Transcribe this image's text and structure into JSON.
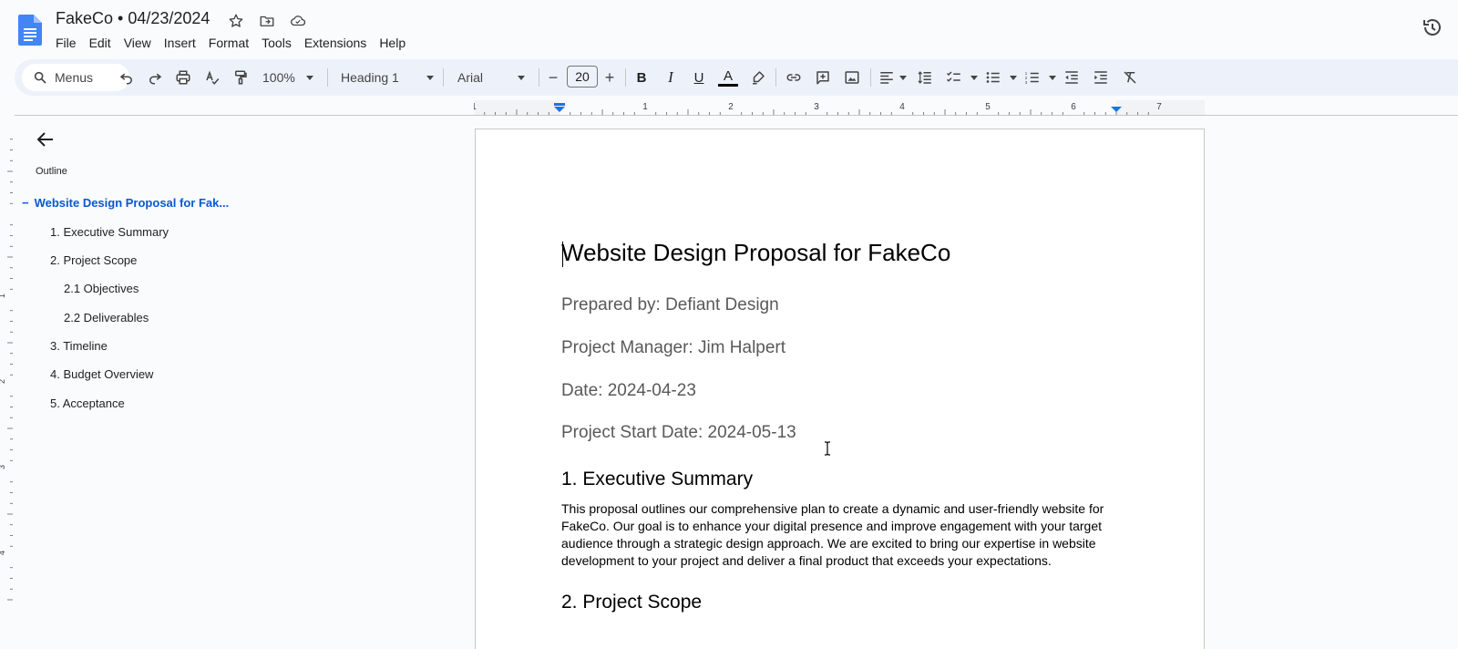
{
  "doc": {
    "title": "FakeCo • 04/23/2024"
  },
  "menu": [
    "File",
    "Edit",
    "View",
    "Insert",
    "Format",
    "Tools",
    "Extensions",
    "Help"
  ],
  "toolbar": {
    "search_label": "Menus",
    "zoom": "100%",
    "style": "Heading 1",
    "font": "Arial",
    "font_size": "20",
    "minus": "−",
    "plus": "+",
    "bold": "B",
    "italic": "I",
    "underline": "U",
    "text_color": "A"
  },
  "sidebar": {
    "outline_label": "Outline",
    "items": [
      {
        "label": "Website Design Proposal for Fak..."
      },
      {
        "label": "1. Executive Summary"
      },
      {
        "label": "2. Project Scope"
      },
      {
        "label": "2.1 Objectives"
      },
      {
        "label": "2.2 Deliverables"
      },
      {
        "label": "3. Timeline"
      },
      {
        "label": "4. Budget Overview"
      },
      {
        "label": "5. Acceptance"
      }
    ],
    "active_dash": "−"
  },
  "ruler": {
    "h_numbers": [
      "1",
      "1",
      "2",
      "3",
      "4",
      "5",
      "6",
      "7"
    ],
    "v_numbers": [
      "1",
      "2",
      "3",
      "4"
    ]
  },
  "page": {
    "title": "Website Design Proposal for FakeCo",
    "prepared_by": "Prepared by: Defiant Design",
    "manager": "Project Manager: Jim Halpert",
    "date": "Date: 2024-04-23",
    "start_date": "Project Start Date: 2024-05-13",
    "h_exec": "1. Executive Summary",
    "exec_para": "This proposal outlines our comprehensive plan to create a dynamic and user-friendly website for FakeCo. Our goal is to enhance your digital presence and improve engagement with your target audience through a strategic design approach. We are excited to bring our expertise in website development to your project and deliver a final product that exceeds your expectations.",
    "h_scope": "2. Project Scope"
  },
  "colors": {
    "accent": "#0b57d0",
    "toolbar_bg": "#edf2fa",
    "page_bg": "#f9fbfd"
  }
}
